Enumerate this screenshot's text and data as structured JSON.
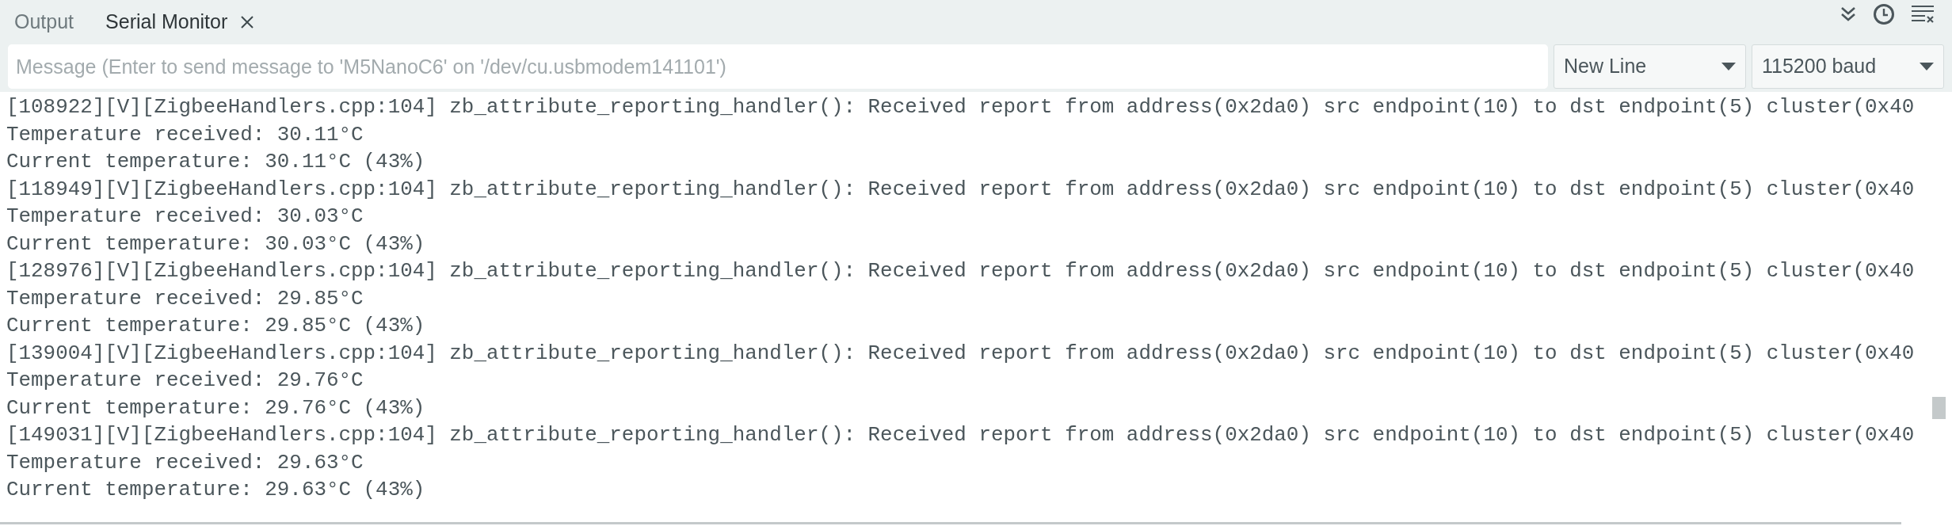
{
  "tabs": [
    {
      "label": "Output",
      "selected": false,
      "closable": false
    },
    {
      "label": "Serial Monitor",
      "selected": true,
      "closable": true
    }
  ],
  "message_field": {
    "placeholder": "Message (Enter to send message to 'M5NanoC6' on '/dev/cu.usbmodem141101')"
  },
  "line_ending": {
    "value": "New Line"
  },
  "baud_rate": {
    "value": "115200 baud"
  },
  "log_lines": [
    "[108922][V][ZigbeeHandlers.cpp:104] zb_attribute_reporting_handler(): Received report from address(0x2da0) src endpoint(10) to dst endpoint(5) cluster(0x40",
    "Temperature received: 30.11°C",
    "Current temperature: 30.11°C (43%)",
    "[118949][V][ZigbeeHandlers.cpp:104] zb_attribute_reporting_handler(): Received report from address(0x2da0) src endpoint(10) to dst endpoint(5) cluster(0x40",
    "Temperature received: 30.03°C",
    "Current temperature: 30.03°C (43%)",
    "[128976][V][ZigbeeHandlers.cpp:104] zb_attribute_reporting_handler(): Received report from address(0x2da0) src endpoint(10) to dst endpoint(5) cluster(0x40",
    "Temperature received: 29.85°C",
    "Current temperature: 29.85°C (43%)",
    "[139004][V][ZigbeeHandlers.cpp:104] zb_attribute_reporting_handler(): Received report from address(0x2da0) src endpoint(10) to dst endpoint(5) cluster(0x40",
    "Temperature received: 29.76°C",
    "Current temperature: 29.76°C (43%)",
    "[149031][V][ZigbeeHandlers.cpp:104] zb_attribute_reporting_handler(): Received report from address(0x2da0) src endpoint(10) to dst endpoint(5) cluster(0x40",
    "Temperature received: 29.63°C",
    "Current temperature: 29.63°C (43%)"
  ]
}
